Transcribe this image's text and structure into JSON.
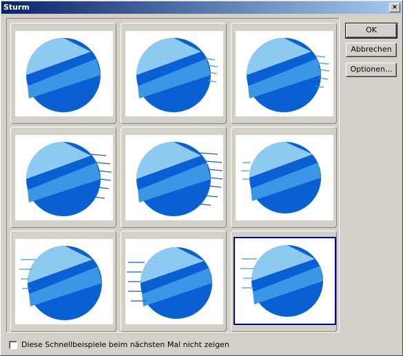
{
  "window": {
    "title": "Sturm",
    "close_glyph": "×"
  },
  "buttons": {
    "ok": "OK",
    "cancel": "Abbrechen",
    "options": "Optionen..."
  },
  "checkbox": {
    "label": "Diese Schnellbeispiele beim nächsten Mal nicht zeigen",
    "checked": false
  },
  "previews": [
    {
      "label": "",
      "selected": false
    },
    {
      "label": "",
      "selected": false
    },
    {
      "label": "",
      "selected": false
    },
    {
      "label": "",
      "selected": false
    },
    {
      "label": "",
      "selected": false
    },
    {
      "label": "",
      "selected": false
    },
    {
      "label": "",
      "selected": false
    },
    {
      "label": "",
      "selected": false
    },
    {
      "label": "",
      "selected": true
    }
  ],
  "colors": {
    "selection_border": "#0000a8",
    "sphere_light": "#8ccaf2",
    "sphere_mid": "#3c96e6",
    "sphere_dark": "#0a5fd2"
  }
}
